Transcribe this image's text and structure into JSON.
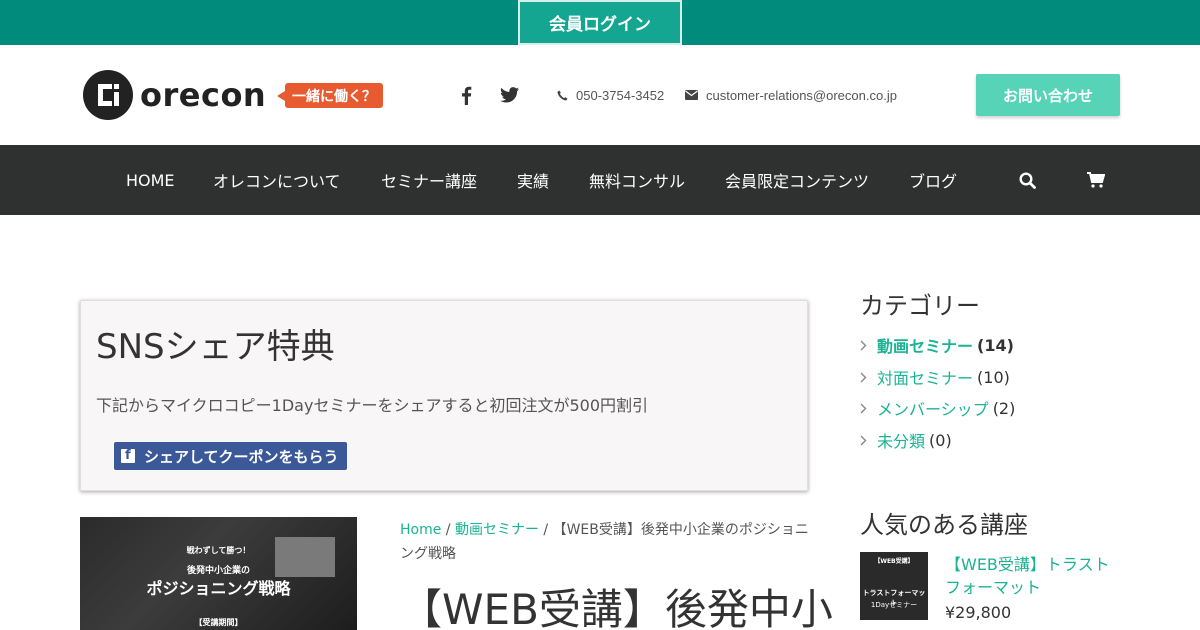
{
  "topbar": {
    "login_label": "会員ログイン"
  },
  "header": {
    "logo_text": "orecon",
    "tagline": "一緒に働く？",
    "phone": "050-3754-3452",
    "email": "customer-relations@orecon.co.jp",
    "inquiry_label": "お問い合わせ"
  },
  "nav": {
    "items": [
      {
        "label": "HOME"
      },
      {
        "label": "オレコンについて"
      },
      {
        "label": "セミナー講座"
      },
      {
        "label": "実績"
      },
      {
        "label": "無料コンサル"
      },
      {
        "label": "会員限定コンテンツ"
      },
      {
        "label": "ブログ"
      }
    ]
  },
  "share": {
    "title": "SNSシェア特典",
    "description": "下記からマイクロコピー1Dayセミナーをシェアすると初回注文が500円割引",
    "button_label": "シェアしてクーポンをもらう"
  },
  "product": {
    "image_lines": [
      "戦わずして勝つ！",
      "後発中小企業の",
      "ポジショニング戦略",
      "【受講期間】"
    ],
    "breadcrumb": {
      "home": "Home",
      "sep1": " / ",
      "category": "動画セミナー",
      "sep2": " / ",
      "current": "【WEB受講】後発中小企業のポジショニング戦略"
    },
    "title": "【WEB受講】後発中小"
  },
  "sidebar": {
    "categories_heading": "カテゴリー",
    "categories": [
      {
        "name": "動画セミナー",
        "count": "(14)"
      },
      {
        "name": "対面セミナー",
        "count": "(10)"
      },
      {
        "name": "メンバーシップ",
        "count": "(2)"
      },
      {
        "name": "未分類",
        "count": "(0)"
      }
    ],
    "popular_heading": "人気のある講座",
    "popular": [
      {
        "image_lines": [
          "【WEB受講】",
          "トラストフォーマット",
          "1Dayセミナー"
        ],
        "title": "【WEB受講】トラストフォーマット",
        "price": "¥29,800"
      }
    ]
  },
  "colors": {
    "topbar": "#008b7d",
    "accent": "#1bb394",
    "nav": "#2f3030",
    "inquiry": "#57d3b8",
    "tagline": "#e85a30",
    "facebook": "#3b5998"
  }
}
